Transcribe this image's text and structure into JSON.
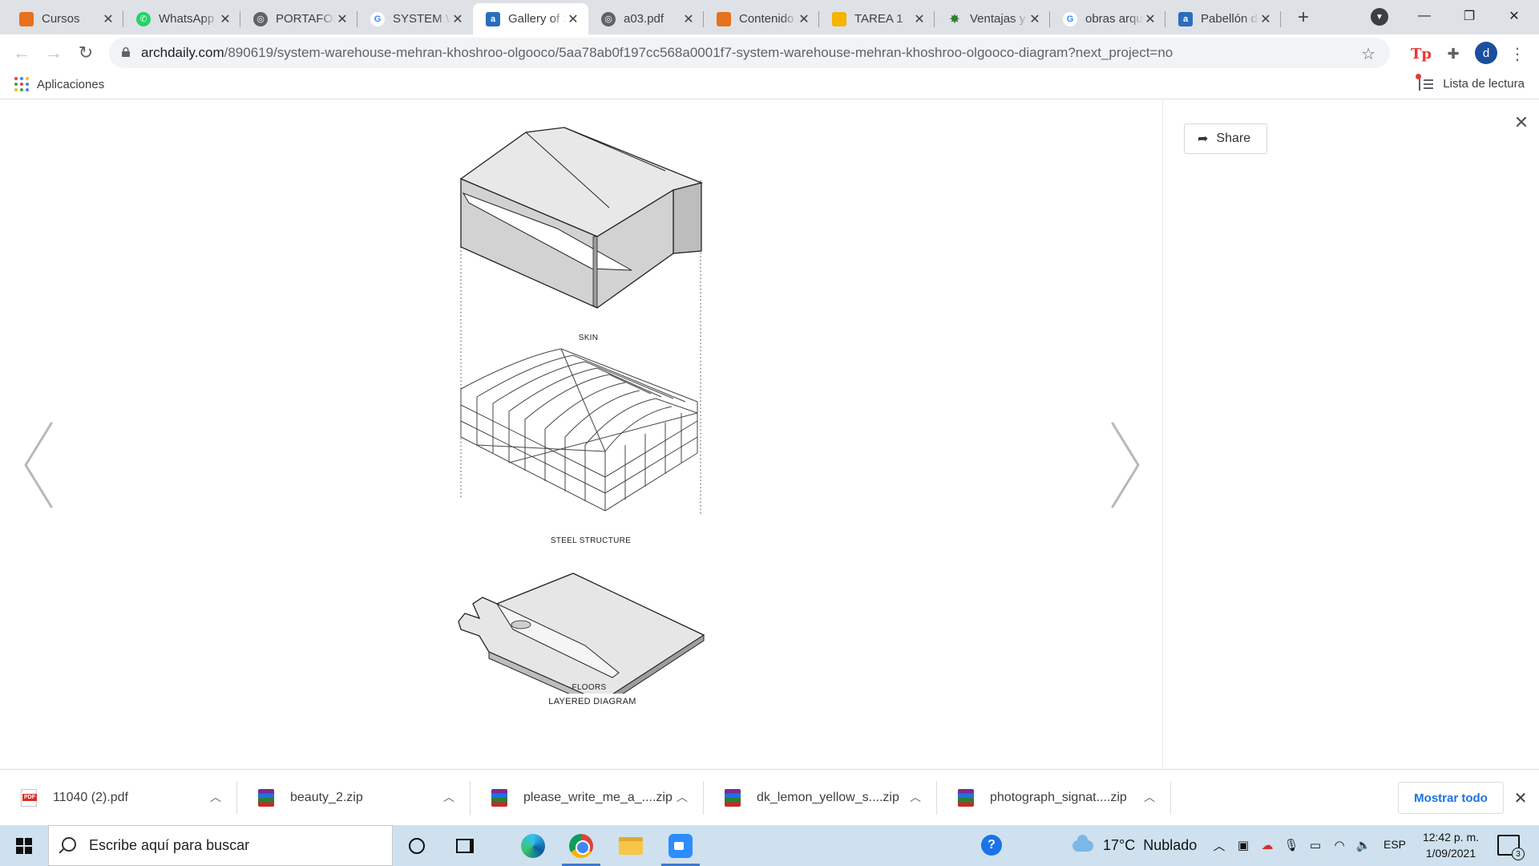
{
  "browser": {
    "tabs": [
      {
        "title": "Cursos",
        "favicon": "orange-square-icon",
        "active": false
      },
      {
        "title": "WhatsApp",
        "favicon": "whatsapp-icon",
        "active": false
      },
      {
        "title": "PORTAFOLIO",
        "favicon": "globe-icon",
        "active": false
      },
      {
        "title": "SYSTEM Warehouse",
        "favicon": "google-icon",
        "active": false
      },
      {
        "title": "Gallery of System Warehouse",
        "favicon": "archdaily-icon",
        "active": true
      },
      {
        "title": "a03.pdf",
        "favicon": "globe-icon",
        "active": false
      },
      {
        "title": "Contenido",
        "favicon": "orange-square-icon",
        "active": false
      },
      {
        "title": "TAREA 1",
        "favicon": "slides-icon",
        "active": false
      },
      {
        "title": "Ventajas y",
        "favicon": "star-burst-icon",
        "active": false
      },
      {
        "title": "obras arquitectura",
        "favicon": "google-icon",
        "active": false
      },
      {
        "title": "Pabellón de",
        "favicon": "archdaily-icon",
        "active": false
      }
    ],
    "url": {
      "host": "archdaily.com",
      "path": "/890619/system-warehouse-mehran-khoshroo-olgooco/5aa78ab0f197cc568a0001f7-system-warehouse-mehran-khoshroo-olgooco-diagram?next_project=no"
    },
    "profile_initial": "d",
    "extension_label": "Tp",
    "bookmarks": {
      "apps_label": "Aplicaciones",
      "reading_list_label": "Lista de lectura"
    }
  },
  "gallery": {
    "share_label": "Share",
    "diagram": {
      "labels": {
        "skin": "SKIN",
        "steel_structure": "STEEL STRUCTURE",
        "floors": "FLOORS",
        "caption": "LAYERED DIAGRAM"
      }
    }
  },
  "downloads": {
    "items": [
      {
        "name": "11040 (2).pdf",
        "type": "pdf-file-icon"
      },
      {
        "name": "beauty_2.zip",
        "type": "winrar-archive-icon"
      },
      {
        "name": "please_write_me_a_....zip",
        "type": "winrar-archive-icon"
      },
      {
        "name": "dk_lemon_yellow_s....zip",
        "type": "winrar-archive-icon"
      },
      {
        "name": "photograph_signat....zip",
        "type": "winrar-archive-icon"
      }
    ],
    "show_all_label": "Mostrar todo"
  },
  "taskbar": {
    "search_placeholder": "Escribe aquí para buscar",
    "weather": {
      "temperature": "17°C",
      "condition": "Nublado"
    },
    "language": "ESP",
    "time": "12:42 p. m.",
    "date": "1/09/2021",
    "notification_count": "3",
    "pinned_apps": [
      "cortana-icon",
      "task-view-icon",
      "edge-icon",
      "chrome-icon",
      "file-explorer-icon",
      "zoom-icon"
    ]
  },
  "colors": {
    "tabstrip_bg": "#dee1e6",
    "accent_blue": "#1a73e8",
    "taskbar_bg": "#cfe1ee",
    "diagram_face_light": "#e6e6e6",
    "diagram_face_dark": "#bdbdbd"
  }
}
